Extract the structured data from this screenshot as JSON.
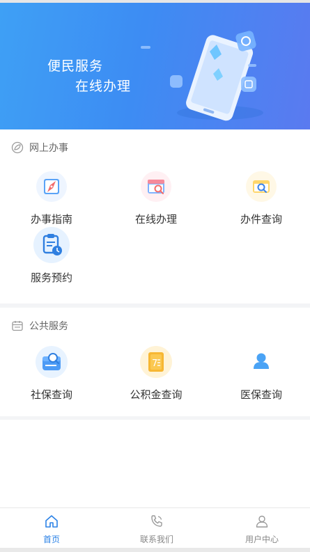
{
  "banner": {
    "line1": "便民服务",
    "line2": "在线办理"
  },
  "online_affairs": {
    "title": "网上办事",
    "items": [
      {
        "label": "办事指南",
        "icon": "compass-icon"
      },
      {
        "label": "在线办理",
        "icon": "calendar-search-icon"
      },
      {
        "label": "办件查询",
        "icon": "magnifier-icon"
      },
      {
        "label": "服务预约",
        "icon": "clipboard-clock-icon"
      }
    ]
  },
  "public_services": {
    "title": "公共服务",
    "items": [
      {
        "label": "社保查询",
        "icon": "social-security-search-icon"
      },
      {
        "label": "公积金查询",
        "icon": "calendar-7-icon"
      },
      {
        "label": "医保查询",
        "icon": "person-icon"
      }
    ]
  },
  "tabbar": {
    "items": [
      {
        "label": "首页",
        "icon": "home-icon",
        "active": true
      },
      {
        "label": "联系我们",
        "icon": "phone-icon",
        "active": false
      },
      {
        "label": "用户中心",
        "icon": "user-icon",
        "active": false
      }
    ]
  },
  "colors": {
    "accent": "#2b82e6",
    "banner_start": "#3ea0f5",
    "banner_end": "#5a7af0"
  }
}
